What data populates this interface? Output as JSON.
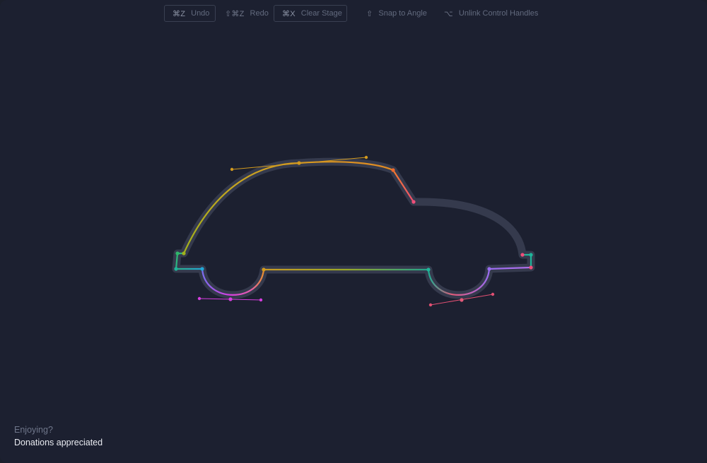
{
  "toolbar": {
    "undo": {
      "key": "⌘Z",
      "label": "Undo"
    },
    "redo": {
      "key": "⇧⌘Z",
      "label": "Redo"
    },
    "clear": {
      "key": "⌘X",
      "label": "Clear Stage"
    },
    "snap": {
      "key": "⇧",
      "label": "Snap to Angle"
    },
    "unlink": {
      "key": "⌥",
      "label": "Unlink Control Handles"
    }
  },
  "footer": {
    "question": "Enjoying?",
    "link": "Donations appreciated"
  },
  "colors": {
    "background": "#1c2030",
    "guide": "#3a3f52",
    "gold": "#d39a1e",
    "orange": "#ef6a2f",
    "pink": "#ee4f7a",
    "magenta": "#d63ee0",
    "violet": "#9a6cf2",
    "teal": "#1fb59a",
    "cyan": "#22a7d8",
    "green": "#2fb66a"
  }
}
